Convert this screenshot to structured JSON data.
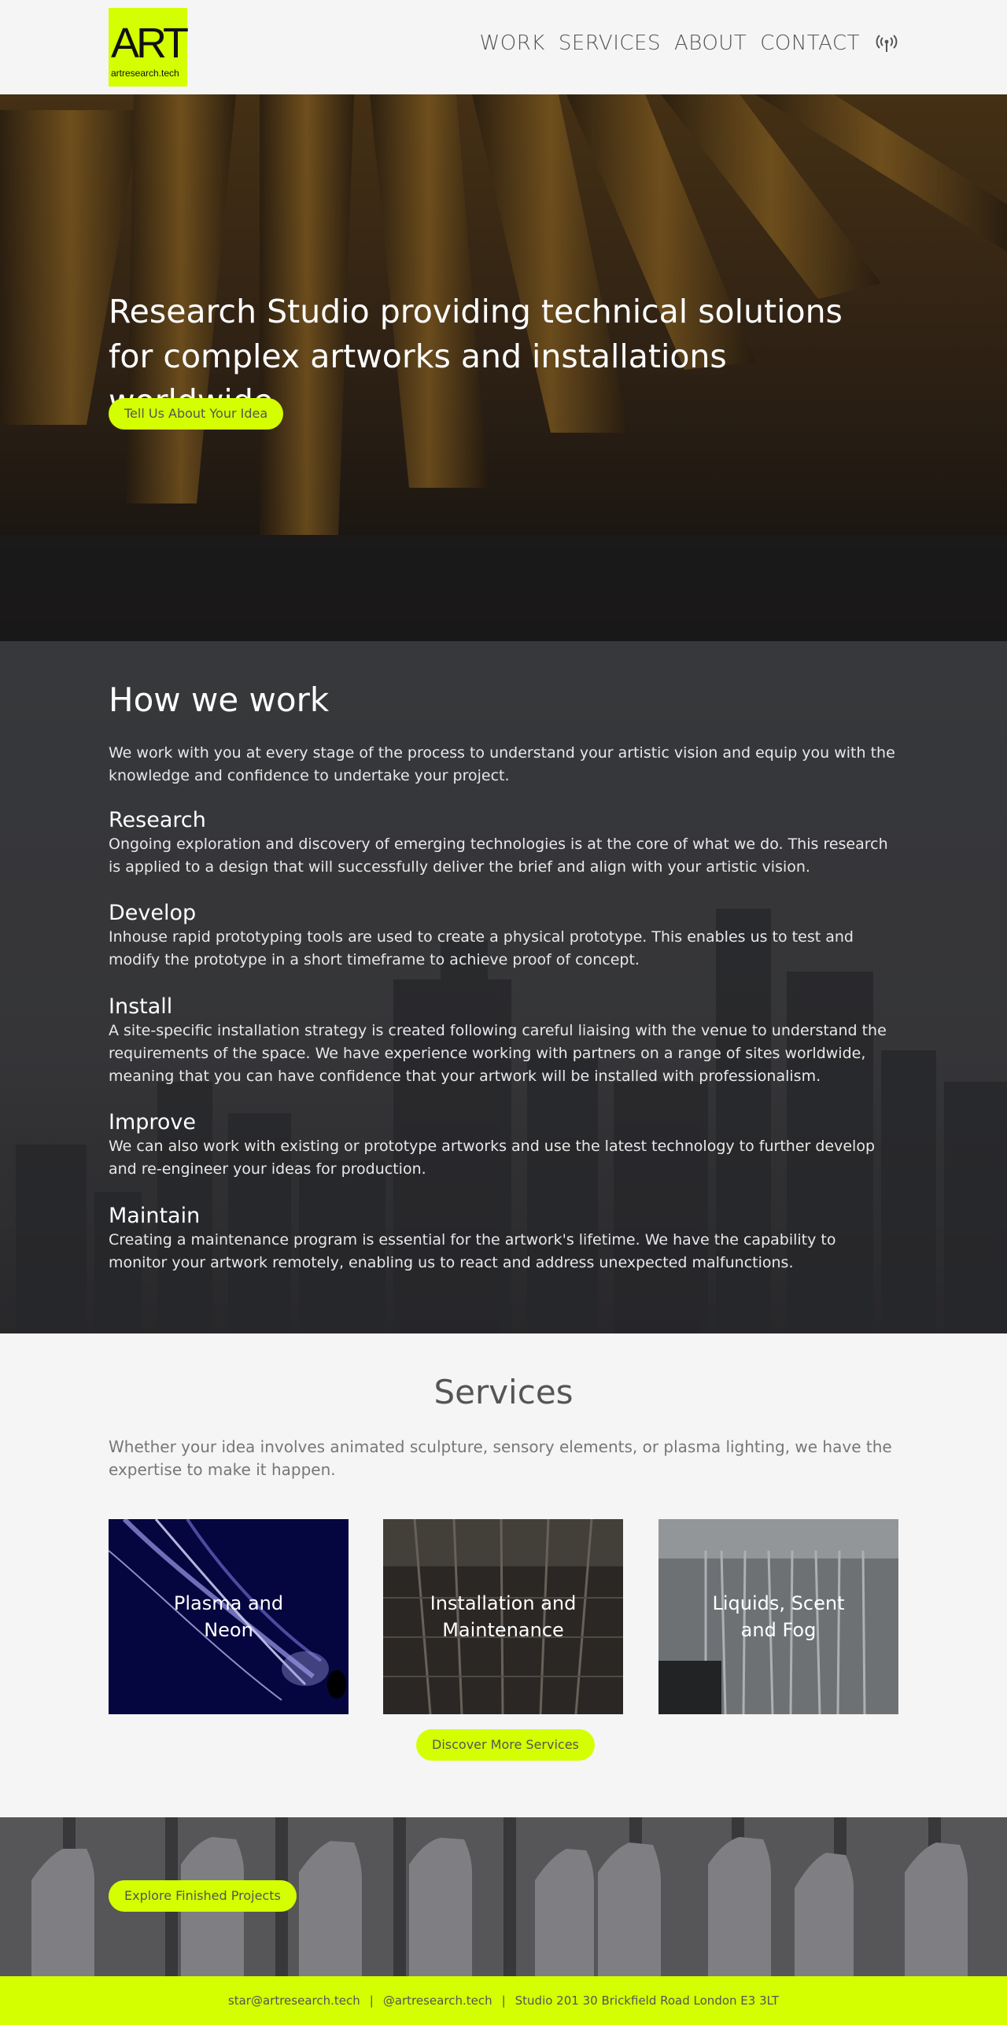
{
  "brand": {
    "logo_text": "ART",
    "logo_subtext": "artresearch.tech",
    "accent_color": "#d4ff00"
  },
  "nav": {
    "items": [
      {
        "label": "WORK"
      },
      {
        "label": "SERVICES"
      },
      {
        "label": "ABOUT"
      },
      {
        "label": "CONTACT"
      }
    ],
    "icon": "broadcast-icon"
  },
  "hero": {
    "title": "Research Studio providing technical solutions for complex artworks and installations worldwide",
    "cta_label": "Tell Us About Your Idea"
  },
  "how": {
    "heading": "How we work",
    "intro": "We work with you at every stage of the process to understand your artistic vision and equip you with the knowledge and confidence to undertake your project.",
    "steps": [
      {
        "title": "Research",
        "text": "Ongoing exploration and discovery of emerging technologies is at the core of what we do. This research is applied to a design that will successfully deliver the brief and align with your artistic vision."
      },
      {
        "title": "Develop",
        "text": "Inhouse rapid prototyping tools are used to create a physical prototype. This enables us to test and modify the prototype in a short timeframe to achieve proof of concept."
      },
      {
        "title": "Install",
        "text": "A site-specific installation strategy is created following careful liaising with the venue to understand the requirements of the space. We have experience working with partners on a range of sites worldwide, meaning that you can have confidence that your artwork will be installed with professionalism."
      },
      {
        "title": "Improve",
        "text": "We can also work with existing or prototype artworks and use the latest technology to further develop and re-engineer your ideas for production."
      },
      {
        "title": "Maintain",
        "text": "Creating a maintenance program is essential for the artwork's lifetime. We have the capability to monitor your artwork remotely, enabling us to react and address unexpected malfunctions."
      }
    ]
  },
  "services": {
    "heading": "Services",
    "intro": "Whether your idea involves animated sculpture, sensory elements, or plasma lighting, we have the expertise to make it happen.",
    "cards": [
      {
        "label": "Plasma and Neon"
      },
      {
        "label": "Installation and Maintenance"
      },
      {
        "label": "Liquids, Scent and Fog"
      }
    ],
    "cta_label": "Discover More Services"
  },
  "projects": {
    "cta_label": "Explore Finished Projects"
  },
  "footer": {
    "email": "star@artresearch.tech",
    "handle": "@artresearch.tech",
    "address": "Studio 201 30 Brickfield Road London E3 3LT",
    "separator": "|"
  }
}
